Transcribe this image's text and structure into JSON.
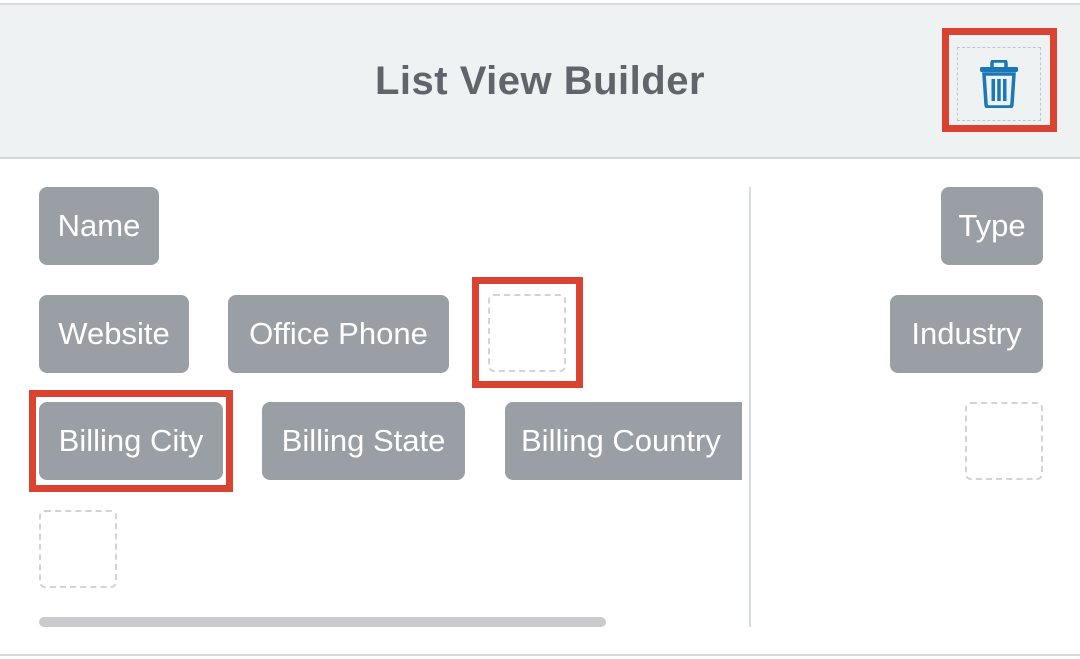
{
  "header": {
    "title": "List View Builder"
  },
  "trash": {
    "icon": "trash-icon"
  },
  "left_panel": {
    "row1": [
      "Name"
    ],
    "row2": [
      "Website",
      "Office Phone"
    ],
    "row3": [
      "Billing City",
      "Billing State",
      "Billing Country"
    ]
  },
  "right_panel": {
    "fields": [
      "Type",
      "Industry"
    ]
  },
  "colors": {
    "pill": "#9a9fa6",
    "highlight": "#d9432f",
    "trash": "#1a78b8",
    "header_bg": "#eff2f3"
  }
}
